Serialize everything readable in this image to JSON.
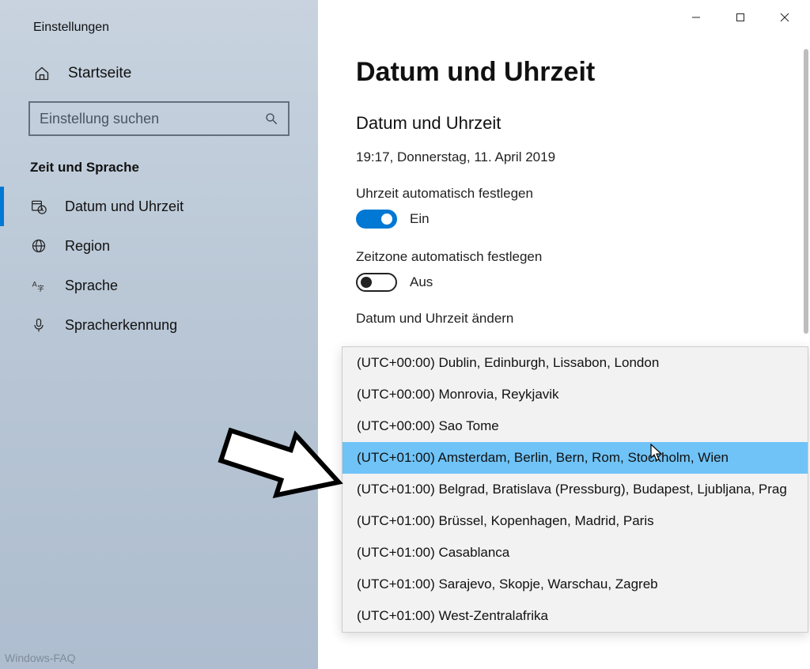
{
  "window": {
    "app_title": "Einstellungen"
  },
  "sidebar": {
    "home_label": "Startseite",
    "search_placeholder": "Einstellung suchen",
    "category_label": "Zeit und Sprache",
    "items": [
      {
        "label": "Datum und Uhrzeit",
        "icon": "calendar-clock-icon",
        "active": true
      },
      {
        "label": "Region",
        "icon": "globe-icon",
        "active": false
      },
      {
        "label": "Sprache",
        "icon": "language-icon",
        "active": false
      },
      {
        "label": "Spracherkennung",
        "icon": "microphone-icon",
        "active": false
      }
    ]
  },
  "main": {
    "page_title": "Datum und Uhrzeit",
    "section_title": "Datum und Uhrzeit",
    "current_datetime": "19:17, Donnerstag, 11. April 2019",
    "toggle_time_auto": {
      "label": "Uhrzeit automatisch festlegen",
      "state_label": "Ein",
      "on": true
    },
    "toggle_tz_auto": {
      "label": "Zeitzone automatisch festlegen",
      "state_label": "Aus",
      "on": false
    },
    "change_label_partial": "Datum und Uhrzeit ändern"
  },
  "timezone_dropdown": {
    "options": [
      "(UTC+00:00) Dublin, Edinburgh, Lissabon, London",
      "(UTC+00:00) Monrovia, Reykjavik",
      "(UTC+00:00) Sao Tome",
      "(UTC+01:00) Amsterdam, Berlin, Bern, Rom, Stockholm, Wien",
      "(UTC+01:00) Belgrad, Bratislava (Pressburg), Budapest, Ljubljana, Prag",
      "(UTC+01:00) Brüssel, Kopenhagen, Madrid, Paris",
      "(UTC+01:00) Casablanca",
      "(UTC+01:00) Sarajevo, Skopje, Warschau, Zagreb",
      "(UTC+01:00) West-Zentralafrika"
    ],
    "selected_index": 3
  },
  "watermark": "Windows-FAQ"
}
